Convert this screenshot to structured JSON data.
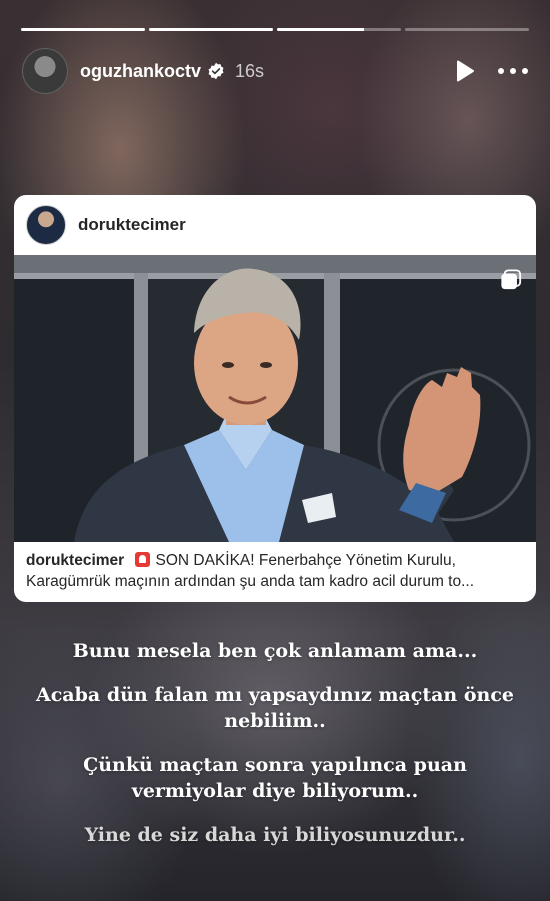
{
  "story": {
    "progress": [
      1,
      1,
      0.7,
      0
    ],
    "username": "oguzhankoctv",
    "time": "16s",
    "icons": {
      "verified": "verified-badge-icon",
      "play": "play-icon",
      "more": "more-options-icon"
    }
  },
  "shared_post": {
    "username": "doruktecimer",
    "caption_user": "doruktecimer",
    "caption_line1": "SON DAKİKA! Fenerbahçe Yönetim Kurulu,",
    "caption_line2": "Karagümrük maçının ardından şu anda tam kadro acil durum to...",
    "icons": {
      "multi_image": "multi-image-icon",
      "siren": "siren-emoji-icon"
    }
  },
  "story_text": [
    "Bunu mesela ben çok anlamam ama...",
    "Acaba dün falan mı yapsaydınız maçtan önce nebiliim..",
    "Çünkü maçtan sonra yapılınca puan vermiyolar diye biliyorum..",
    "Yine de siz daha iyi biliyosunuzdur.."
  ],
  "colors": {
    "accent_siren": "#e53935",
    "card_bg": "#ffffff",
    "shirt": "#8fb4e0",
    "suit": "#2e3440"
  }
}
